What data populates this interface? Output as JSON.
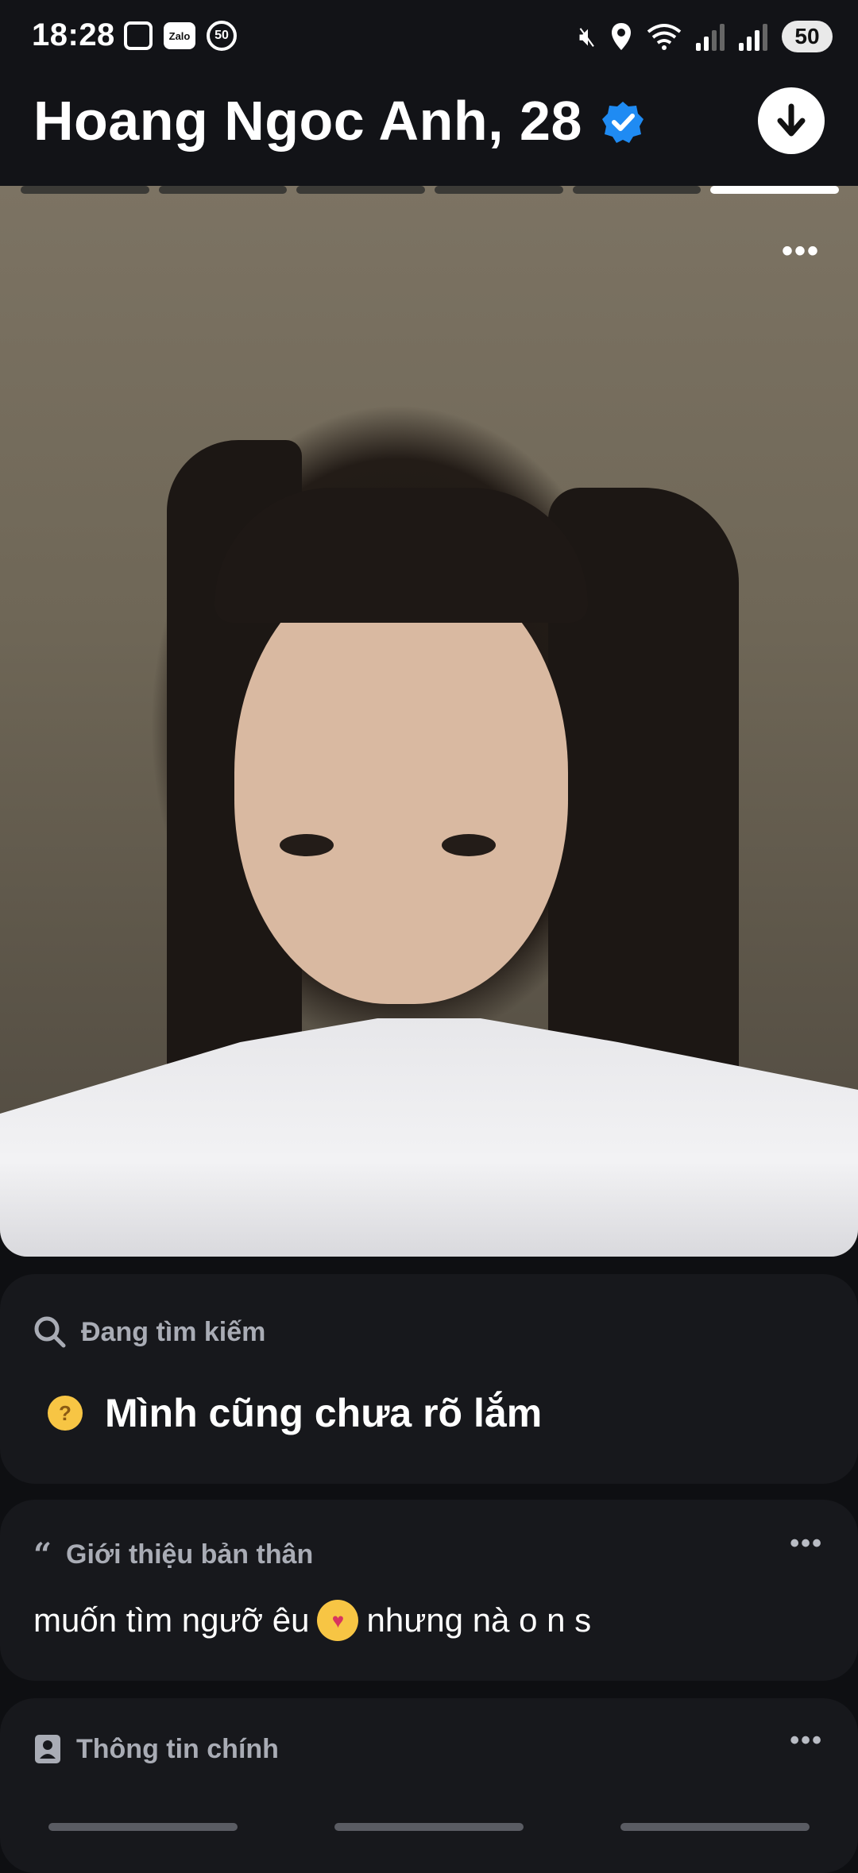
{
  "status_bar": {
    "time": "18:28",
    "badge_number": "50",
    "battery": "50",
    "network_label": "5",
    "icons": [
      "screenshot-icon",
      "zalo-icon",
      "mute-icon",
      "location-icon",
      "wifi-icon",
      "signal-icon"
    ]
  },
  "header": {
    "name_age": "Hoang Ngoc Anh, 28",
    "verified_icon": "verified-badge-icon",
    "action_icon": "arrow-down-icon"
  },
  "photo": {
    "progress_count": 6,
    "active_index": 5,
    "more_label": "•••"
  },
  "looking_for": {
    "heading": "Đang tìm kiếm",
    "value": "Mình cũng chưa rõ lắm",
    "emoji": "thinking-face-emoji"
  },
  "about": {
    "heading": "Giới thiệu bản thân",
    "text_before": "muốn tìm ngưỡ êu",
    "text_after": "nhưng nà o n s",
    "more_label": "•••"
  },
  "basics": {
    "heading": "Thông tin chính",
    "more_label": "•••"
  },
  "colors": {
    "background": "#0e0f12",
    "card": "#17181c",
    "accent_verified": "#1f8bf3"
  }
}
